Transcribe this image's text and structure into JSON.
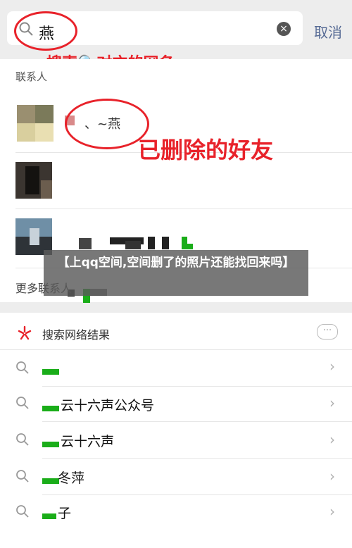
{
  "search": {
    "query": "燕",
    "cancel_label": "取消",
    "clear_icon": "×"
  },
  "annotations": {
    "search_hint": "搜索🔍对方的网名",
    "deleted_friend": "已删除的好友"
  },
  "contacts": {
    "section_label": "联系人",
    "first_name_suffix": "、~燕",
    "more_label": "更多联系人"
  },
  "overlay_title": "【上qq空间,空间删了的照片还能找回来吗】",
  "network_results": {
    "section_label": "搜索网络结果",
    "more_icon": "···",
    "rows": [
      {
        "text": ""
      },
      {
        "text": "云十六声公众号"
      },
      {
        "text": "云十六声"
      },
      {
        "text": "冬萍"
      },
      {
        "text": "子"
      }
    ]
  },
  "colors": {
    "accent_red": "#e8222a",
    "link_blue": "#576b95",
    "wechat_green": "#1aad19"
  }
}
